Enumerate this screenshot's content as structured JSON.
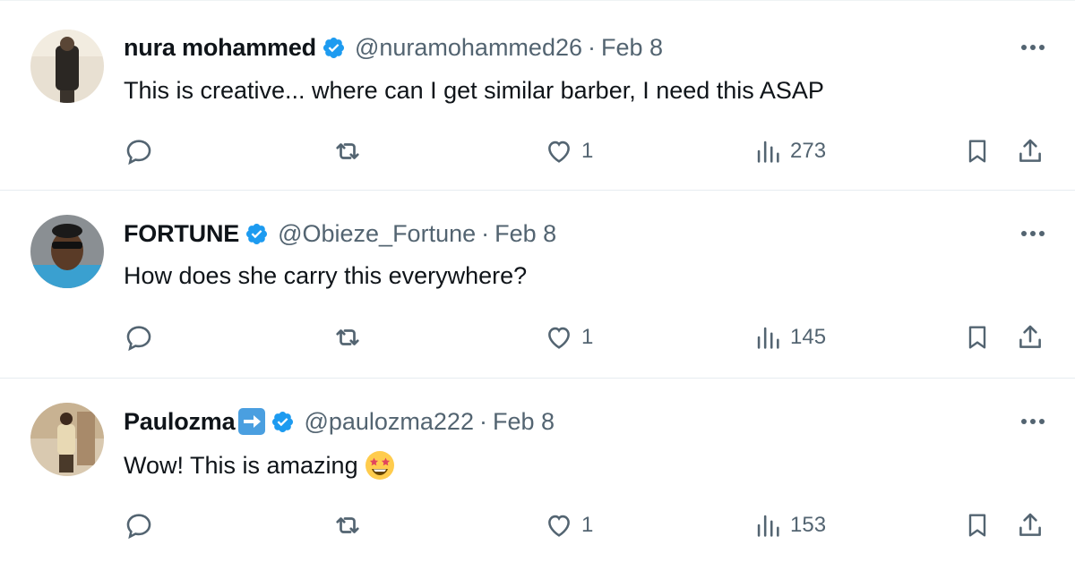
{
  "tweets": [
    {
      "name": "nura mohammed",
      "handle": "@nuramohammed26",
      "separator": "·",
      "date": "Feb 8",
      "text": "This is creative... where can I get similar barber, I need this ASAP",
      "likes": "1",
      "views": "273",
      "extra_badge": false,
      "emoji": ""
    },
    {
      "name": "FORTUNE",
      "handle": "@Obieze_Fortune",
      "separator": "·",
      "date": "Feb 8",
      "text": "How does she carry this everywhere?",
      "likes": "1",
      "views": "145",
      "extra_badge": false,
      "emoji": ""
    },
    {
      "name": "Paulozma",
      "handle": "@paulozma222",
      "separator": "·",
      "date": "Feb 8",
      "text": "Wow! This is amazing",
      "likes": "1",
      "views": "153",
      "extra_badge": true,
      "emoji": "star-struck"
    }
  ],
  "icons": {
    "reply": "reply-icon",
    "retweet": "retweet-icon",
    "like": "heart-icon",
    "views": "views-icon",
    "bookmark": "bookmark-icon",
    "share": "share-icon",
    "more": "more-icon",
    "verified": "verified-badge-icon"
  },
  "colors": {
    "verified_blue": "#1d9bf0",
    "secondary_text": "#536471",
    "primary_text": "#0f1419"
  }
}
